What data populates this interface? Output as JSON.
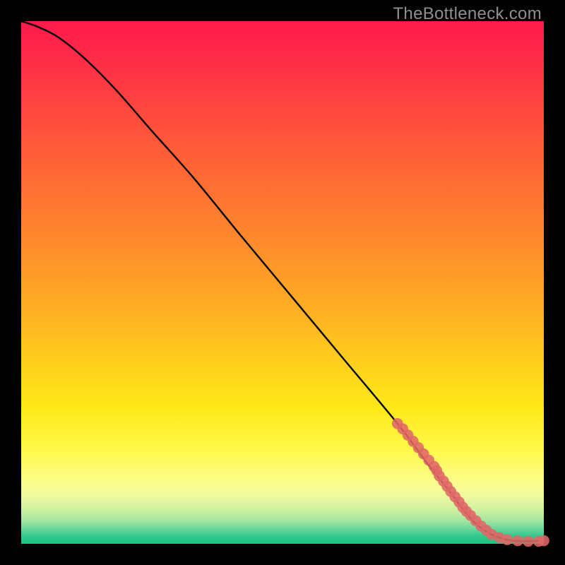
{
  "watermark": "TheBottleneck.com",
  "chart_data": {
    "type": "line",
    "title": "",
    "xlabel": "",
    "ylabel": "",
    "xlim": [
      0,
      100
    ],
    "ylim": [
      0,
      100
    ],
    "grid": false,
    "series": [
      {
        "name": "curve",
        "color": "#000000",
        "x": [
          0,
          3,
          7,
          12,
          18,
          25,
          33,
          42,
          52,
          62,
          72,
          78,
          82,
          85,
          88,
          92,
          96,
          100
        ],
        "y": [
          100,
          99,
          97,
          93,
          87,
          79,
          70,
          59,
          47,
          35,
          23,
          15,
          10,
          6,
          3,
          1,
          0.5,
          0.6
        ]
      }
    ],
    "markers": [
      {
        "name": "cluster",
        "color": "#e06666",
        "x": [
          72,
          73,
          74,
          75,
          76,
          77,
          78,
          79,
          79.5,
          80,
          80.8,
          81.5,
          82.2,
          83,
          83.8,
          84.5,
          85.2,
          86,
          87,
          88,
          89,
          90,
          91.5,
          93,
          95,
          97,
          99,
          100
        ],
        "y": [
          23,
          22,
          20.8,
          19.6,
          18.4,
          17.2,
          16,
          14.8,
          14,
          13,
          12,
          11,
          10,
          9,
          8,
          7,
          6.2,
          5.4,
          4.4,
          3.4,
          2.6,
          1.8,
          1.2,
          0.8,
          0.6,
          0.5,
          0.5,
          0.6
        ]
      }
    ]
  }
}
